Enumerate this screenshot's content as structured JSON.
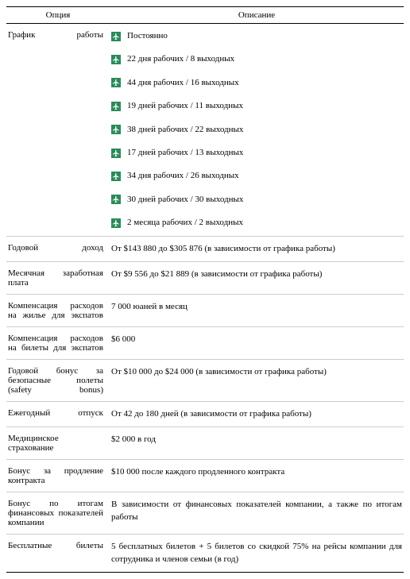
{
  "header": {
    "option": "Опция",
    "description": "Описание"
  },
  "rows": [
    {
      "label": "График работы",
      "schedule": [
        "Постоянно",
        "22 дня рабочих / 8 выходных",
        "44 дня рабочих / 16 выходных",
        "19 дней рабочих / 11 выходных",
        "38 дней рабочих / 22 выходных",
        "17 дней рабочих / 13 выходных",
        "34 дня рабочих / 26 выходных",
        "30 дней рабочих / 30 выходных",
        "2 месяца рабочих / 2 выходных"
      ]
    },
    {
      "label": "Годовой доход",
      "desc": "От $143 880 до $305 876 (в зависимости от графика работы)"
    },
    {
      "label": "Месячная заработная плата",
      "desc": "От $9 556 до $21 889 (в зависимости от графика работы)"
    },
    {
      "label": "Компенсация расходов на жилье для экспатов",
      "desc": "7 000 юаней в месяц"
    },
    {
      "label": "Компенсация расходов на билеты для экспатов",
      "desc": "$6 000"
    },
    {
      "label": "Годовой бонус за безопасные полеты (safety bonus)",
      "desc": "От $10 000 до $24 000 (в зависимости от графика работы)"
    },
    {
      "label": "Ежегодный отпуск",
      "desc": "От 42 до 180 дней (в зависимости от графика работы)"
    },
    {
      "label": "Медицинское страхование",
      "desc": "$2 000 в год"
    },
    {
      "label": "Бонус за продление контракта",
      "desc": "$10 000 после каждого продленного контракта"
    },
    {
      "label": "Бонус по итогам финансовых показателей компании",
      "desc": "В зависимости от финансовых показателей компании, а также по итогам работы"
    },
    {
      "label": "Бесплатные билеты",
      "desc": "5 бесплатных билетов + 5 билетов со скидкой 75% на рейсы компании для сотрудника и членов семьи (в год)"
    }
  ]
}
